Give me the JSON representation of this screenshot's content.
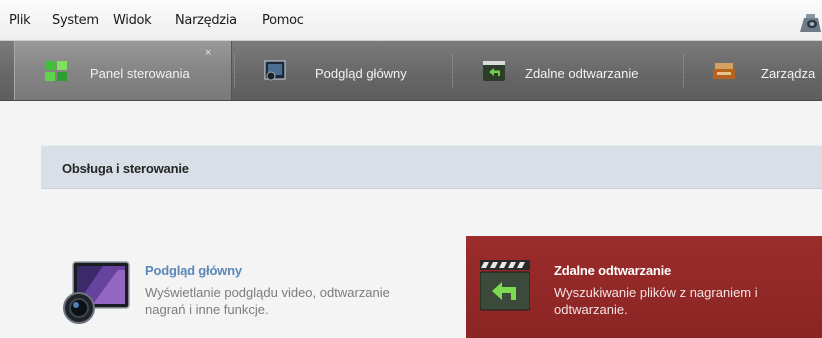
{
  "menu": {
    "items": [
      "Plik",
      "System",
      "Widok",
      "Narzędzia",
      "Pomoc"
    ]
  },
  "tabs": [
    {
      "label": "Panel sterowania",
      "icon": "grid-panel-icon",
      "active": true,
      "close": "×"
    },
    {
      "label": "Podgląd główny",
      "icon": "camera-preview-icon"
    },
    {
      "label": "Zdalne odtwarzanie",
      "icon": "playback-return-icon"
    },
    {
      "label": "Zarządza",
      "icon": "device-management-icon"
    }
  ],
  "section": {
    "title": "Obsługa i sterowanie"
  },
  "cards": {
    "podglad": {
      "title": "Podgląd główny",
      "description": "Wyświetlanie podglądu video, odtwarzanie nagrań i inne funkcje.",
      "icon": "monitor-camera-icon"
    },
    "zdalne": {
      "title": "Zdalne odtwarzanie",
      "description": "Wyszukiwanie plików z nagraniem i odtwarzanie.",
      "icon": "clapperboard-return-icon",
      "background": "#8f2827"
    }
  },
  "colors": {
    "tabbar": "#666666",
    "section_header": "#d8dfe6",
    "card_title_link": "#5b87b7",
    "highlight_card": "#8f2827"
  }
}
